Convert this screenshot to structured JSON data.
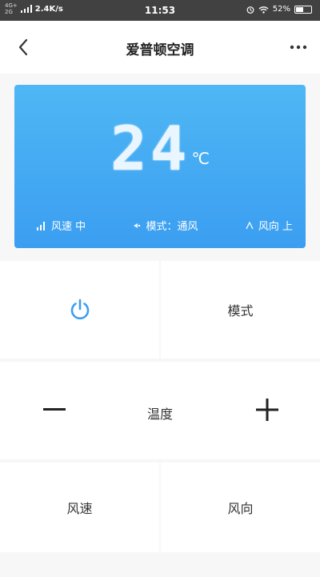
{
  "status_bar": {
    "network_top": "4G+",
    "network_bottom": "2G",
    "speed": "2.4K/s",
    "time": "11:53",
    "battery_text": "52%",
    "battery_level": 0.52,
    "icons": [
      "signal-icon",
      "alarm-icon",
      "wifi-icon",
      "battery-icon"
    ]
  },
  "header": {
    "title": "爱普顿空调",
    "back_icon": "chevron-left-icon",
    "more_icon": "more-dots-icon"
  },
  "display": {
    "temperature": "24",
    "unit": "℃",
    "fan_speed": "风速 中",
    "mode": "模式：通风",
    "direction": "风向 上",
    "gradient": [
      "#4fb7f4",
      "#3b9ef1"
    ]
  },
  "controls": {
    "power_icon": "power-icon",
    "power_color": "#3b9ef1",
    "mode_label": "模式",
    "temp_label": "温度",
    "minus_icon": "minus-icon",
    "plus_icon": "plus-icon",
    "fan_speed_label": "风速",
    "direction_label": "风向"
  }
}
